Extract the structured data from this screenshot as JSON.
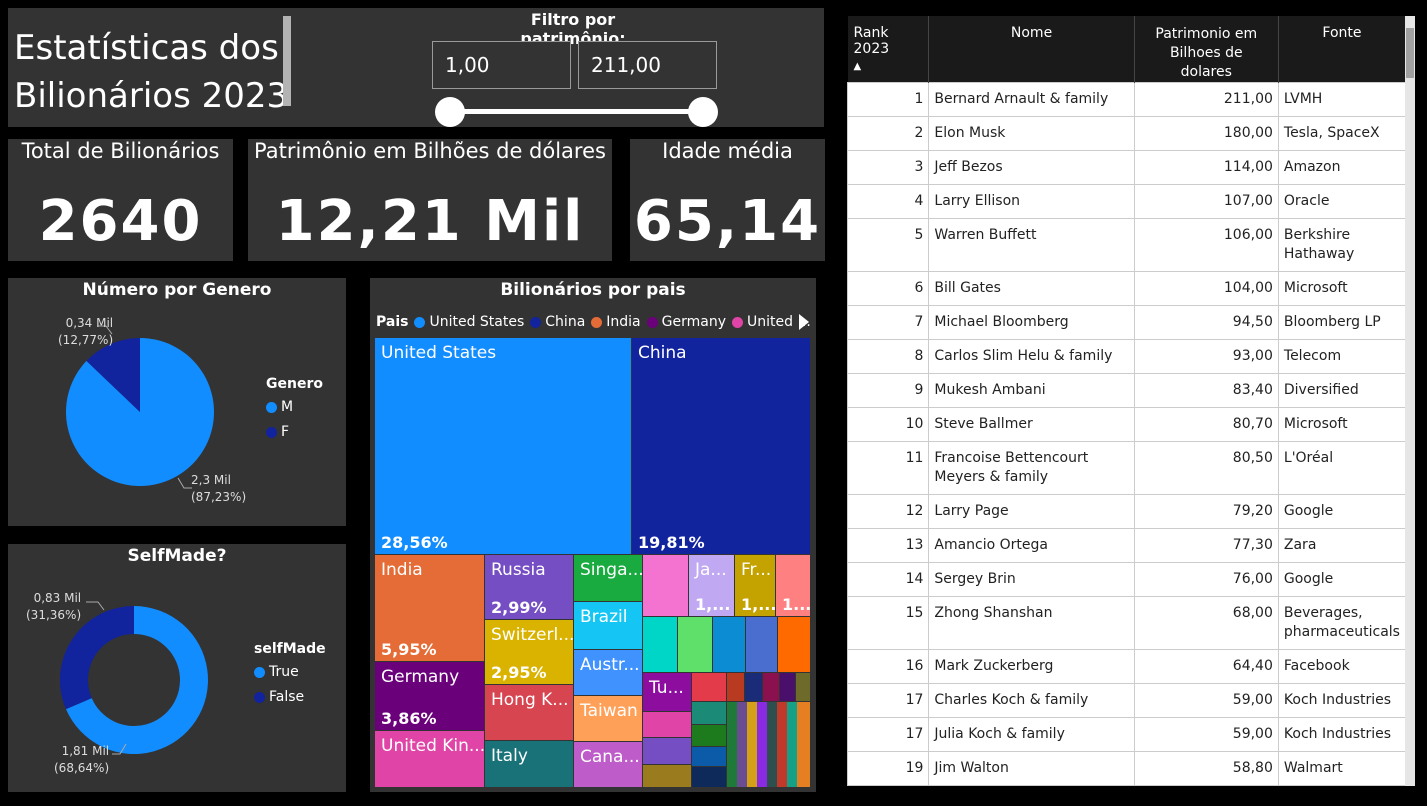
{
  "header": {
    "title_line1": "Estatísticas dos",
    "title_line2": "Bilionários 2023",
    "filter_label": "Filtro por patrimônio:",
    "filter_min": "1,00",
    "filter_max": "211,00"
  },
  "kpis": {
    "total_label": "Total de Bilionários",
    "total_value": "2640",
    "wealth_label": "Patrimônio em Bilhões de dólares",
    "wealth_value": "12,21 Mil",
    "age_label": "Idade média",
    "age_value": "65,14"
  },
  "gender_chart": {
    "title": "Número por Genero",
    "legend_title": "Genero",
    "labels": [
      "M",
      "F"
    ],
    "values": [
      2.3,
      0.34
    ],
    "percents": [
      87.23,
      12.77
    ],
    "colors": [
      "#118DFF",
      "#12239E"
    ],
    "label_m_value": "2,3 Mil",
    "label_m_pct": "(87,23%)",
    "label_f_value": "0,34 Mil",
    "label_f_pct": "(12,77%)"
  },
  "selfmade_chart": {
    "title": "SelfMade?",
    "legend_title": "selfMade",
    "labels": [
      "True",
      "False"
    ],
    "values": [
      1.81,
      0.83
    ],
    "percents": [
      68.64,
      31.36
    ],
    "colors": [
      "#118DFF",
      "#12239E"
    ],
    "label_true_value": "1,81 Mil",
    "label_true_pct": "(68,64%)",
    "label_false_value": "0,83 Mil",
    "label_false_pct": "(31,36%)"
  },
  "country_chart": {
    "title": "Bilionários por pais",
    "legend_title": "Pais",
    "legend_items": [
      {
        "label": "United States",
        "color": "#118DFF"
      },
      {
        "label": "China",
        "color": "#12239E"
      },
      {
        "label": "India",
        "color": "#E66C37"
      },
      {
        "label": "Germany",
        "color": "#6B007B"
      },
      {
        "label": "United ...",
        "color": "#E044A7"
      }
    ],
    "cells": [
      {
        "name": "United States",
        "pct": "28,56%",
        "color": "#118DFF"
      },
      {
        "name": "China",
        "pct": "19,81%",
        "color": "#12239E"
      },
      {
        "name": "India",
        "pct": "5,95%",
        "color": "#E66C37"
      },
      {
        "name": "Germany",
        "pct": "3,86%",
        "color": "#6B007B"
      },
      {
        "name": "United Kin...",
        "pct": "",
        "color": "#E044A7"
      },
      {
        "name": "Russia",
        "pct": "2,99%",
        "color": "#744EC2"
      },
      {
        "name": "Switzerl...",
        "pct": "2,95%",
        "color": "#D9B300"
      },
      {
        "name": "Hong K...",
        "pct": "",
        "color": "#D64550"
      },
      {
        "name": "Italy",
        "pct": "",
        "color": "#197278"
      },
      {
        "name": "Singa...",
        "pct": "",
        "color": "#1AAB40"
      },
      {
        "name": "Brazil",
        "pct": "",
        "color": "#15C6F4"
      },
      {
        "name": "Austr...",
        "pct": "",
        "color": "#4092FF"
      },
      {
        "name": "Taiwan",
        "pct": "",
        "color": "#FFA058"
      },
      {
        "name": "Cana...",
        "pct": "",
        "color": "#BE5DC9"
      },
      {
        "name": "Ja...",
        "pct": "1,...",
        "color": "#C0A9F2"
      },
      {
        "name": "Fr...",
        "pct": "1,...",
        "color": "#C4A200"
      },
      {
        "name": "",
        "pct": "1...",
        "color": "#FF8080"
      },
      {
        "name": "Tu...",
        "pct": "",
        "color": "#8D0E9E"
      }
    ]
  },
  "table": {
    "headers": [
      "Rank 2023",
      "Nome",
      "Patrimonio em Bilhoes de dolares",
      "Fonte"
    ],
    "rows": [
      {
        "rank": "1",
        "name": "Bernard Arnault & family",
        "value": "211,00",
        "source": "LVMH"
      },
      {
        "rank": "2",
        "name": "Elon Musk",
        "value": "180,00",
        "source": "Tesla, SpaceX"
      },
      {
        "rank": "3",
        "name": "Jeff Bezos",
        "value": "114,00",
        "source": "Amazon"
      },
      {
        "rank": "4",
        "name": "Larry Ellison",
        "value": "107,00",
        "source": "Oracle"
      },
      {
        "rank": "5",
        "name": "Warren Buffett",
        "value": "106,00",
        "source": "Berkshire Hathaway"
      },
      {
        "rank": "6",
        "name": "Bill Gates",
        "value": "104,00",
        "source": "Microsoft"
      },
      {
        "rank": "7",
        "name": "Michael Bloomberg",
        "value": "94,50",
        "source": "Bloomberg LP"
      },
      {
        "rank": "8",
        "name": "Carlos Slim Helu & family",
        "value": "93,00",
        "source": "Telecom"
      },
      {
        "rank": "9",
        "name": "Mukesh Ambani",
        "value": "83,40",
        "source": "Diversified"
      },
      {
        "rank": "10",
        "name": "Steve Ballmer",
        "value": "80,70",
        "source": "Microsoft"
      },
      {
        "rank": "11",
        "name": "Francoise Bettencourt Meyers & family",
        "value": "80,50",
        "source": "L'Oréal"
      },
      {
        "rank": "12",
        "name": "Larry Page",
        "value": "79,20",
        "source": "Google"
      },
      {
        "rank": "13",
        "name": "Amancio Ortega",
        "value": "77,30",
        "source": "Zara"
      },
      {
        "rank": "14",
        "name": "Sergey Brin",
        "value": "76,00",
        "source": "Google"
      },
      {
        "rank": "15",
        "name": "Zhong Shanshan",
        "value": "68,00",
        "source": "Beverages, pharmaceuticals"
      },
      {
        "rank": "16",
        "name": "Mark Zuckerberg",
        "value": "64,40",
        "source": "Facebook"
      },
      {
        "rank": "17",
        "name": "Charles Koch & family",
        "value": "59,00",
        "source": "Koch Industries"
      },
      {
        "rank": "17",
        "name": "Julia Koch & family",
        "value": "59,00",
        "source": "Koch Industries"
      },
      {
        "rank": "19",
        "name": "Jim Walton",
        "value": "58,80",
        "source": "Walmart"
      }
    ]
  }
}
